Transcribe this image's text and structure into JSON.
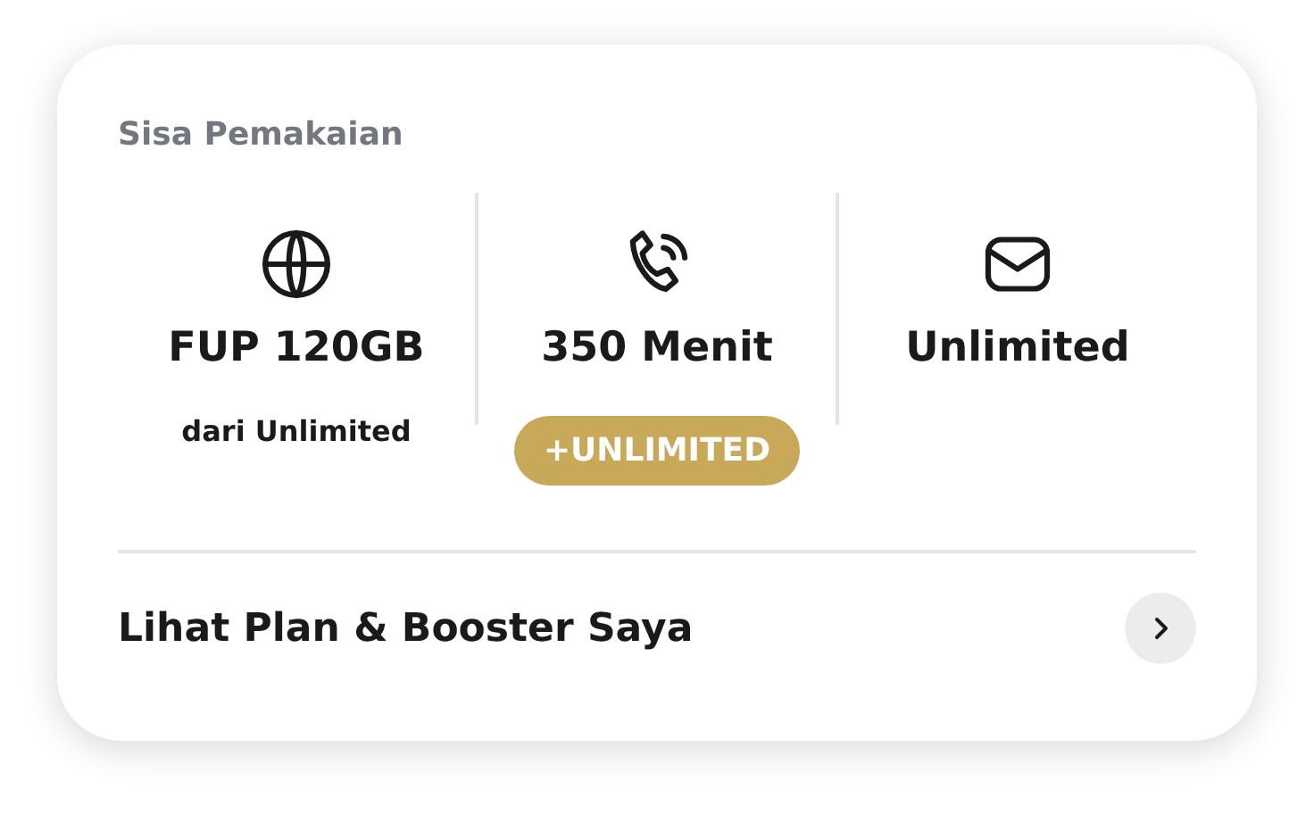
{
  "card": {
    "title": "Sisa Pemakaian",
    "items": [
      {
        "kind": "globe",
        "value": "FUP 120GB",
        "note": "dari Unlimited"
      },
      {
        "kind": "phone",
        "value": "350 Menit",
        "badge": "+UNLIMITED"
      },
      {
        "kind": "mail",
        "value": "Unlimited"
      }
    ],
    "link": {
      "label": "Lihat Plan & Booster Saya"
    }
  }
}
